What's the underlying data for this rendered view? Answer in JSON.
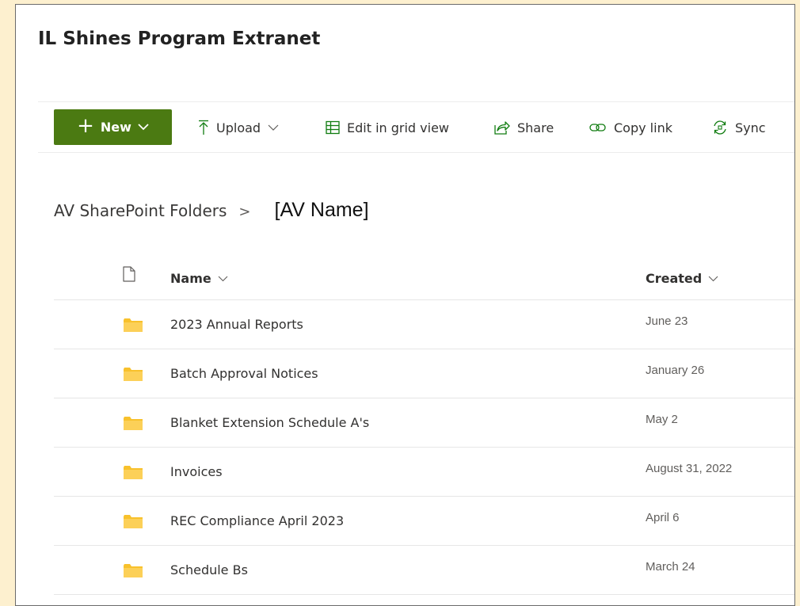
{
  "site": {
    "title": "IL Shines Program Extranet"
  },
  "command_bar": {
    "new_label": "New",
    "upload_label": "Upload",
    "grid_label": "Edit in grid view",
    "share_label": "Share",
    "copy_link_label": "Copy link",
    "sync_label": "Sync",
    "accent": "#4b7a12"
  },
  "breadcrumb": {
    "root": "AV SharePoint Folders",
    "separator": ">",
    "current": "[AV Name]"
  },
  "list": {
    "columns": {
      "name": "Name",
      "created": "Created"
    },
    "rows": [
      {
        "name": "2023 Annual Reports",
        "created": "June 23"
      },
      {
        "name": "Batch Approval Notices",
        "created": "January 26"
      },
      {
        "name": "Blanket Extension Schedule A's",
        "created": "May 2"
      },
      {
        "name": "Invoices",
        "created": "August 31, 2022"
      },
      {
        "name": "REC Compliance April 2023",
        "created": "April 6"
      },
      {
        "name": "Schedule Bs",
        "created": "March 24"
      }
    ]
  },
  "icons": {
    "new": "plus-icon",
    "new_chevron": "chevron-down-icon",
    "upload": "upload-arrow-icon",
    "grid": "grid-table-icon",
    "share": "share-icon",
    "copy_link": "link-icon",
    "sync": "sync-icon",
    "file_type": "document-icon",
    "folder": "folder-icon"
  },
  "colors": {
    "background": "#fdf0cf",
    "folder": "#f8c12c"
  }
}
